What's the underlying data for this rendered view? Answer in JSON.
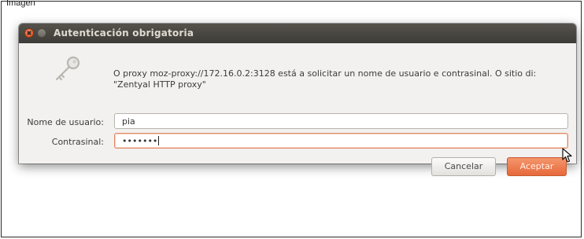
{
  "page": {
    "corner_text": "Imagen"
  },
  "dialog": {
    "title": "Autenticación obrigatoria",
    "message": "O proxy moz-proxy://172.16.0.2:3128 está a solicitar un nome de usuario e contrasinal. O sitio di: \"Zentyal HTTP proxy\"",
    "username_label": "Nome de usuario:",
    "username_value": "pia",
    "password_label": "Contrasinal:",
    "password_value": "•••••••",
    "cancel_label": "Cancelar",
    "accept_label": "Aceptar"
  },
  "icons": {
    "close": "close-icon",
    "minimize": "minimize-icon",
    "key": "key-icon",
    "cursor": "mouse-pointer-icon"
  },
  "colors": {
    "titlebar": "#3e3c38",
    "accent": "#e6693a",
    "dialog_bg": "#f2f1f0"
  }
}
